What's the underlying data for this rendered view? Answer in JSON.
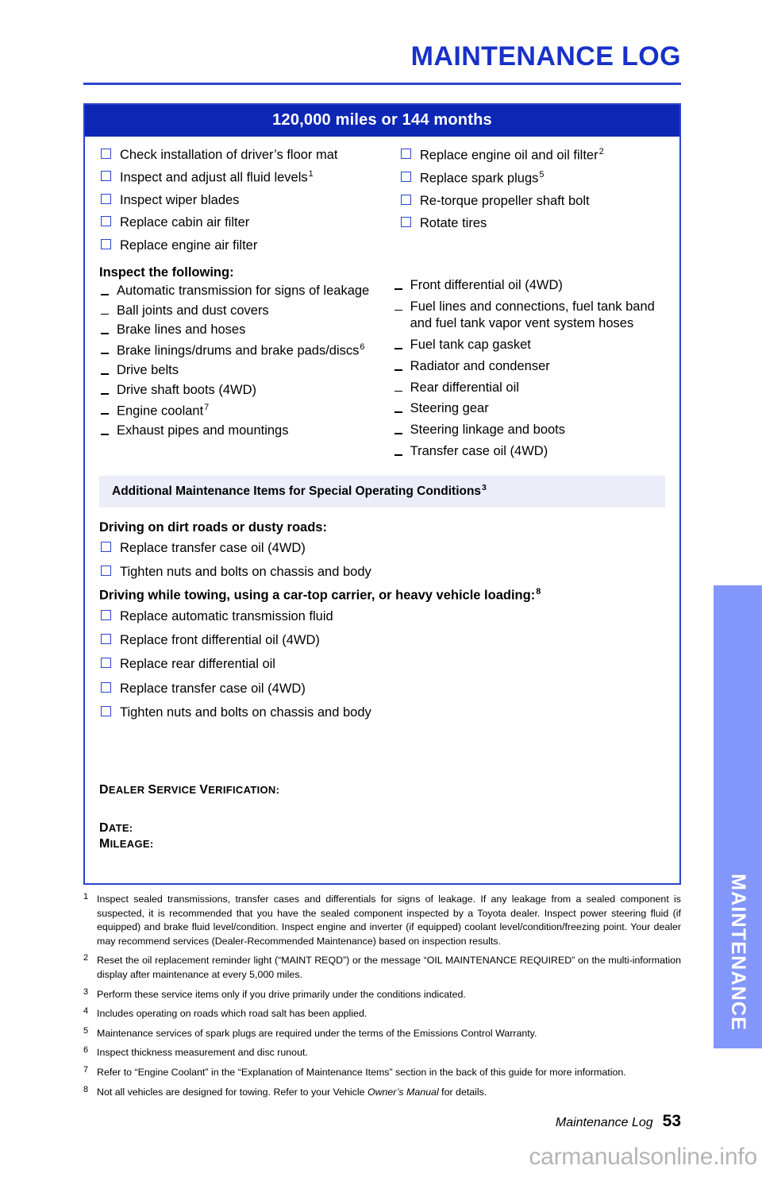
{
  "page": {
    "title": "MAINTENANCE LOG",
    "footer_label": "Maintenance Log",
    "page_number": "53",
    "side_tab": "MAINTENANCE",
    "watermark": "carmanualsonline.info"
  },
  "colors": {
    "brand_blue": "#1731c9",
    "header_bar": "#0d27b5",
    "border_blue": "#2b44cc",
    "banner_bg": "#ebedf8",
    "tab_blue": "#8296fb"
  },
  "log": {
    "interval_header": "120,000 miles or 144 months",
    "checklist_left": [
      {
        "label": "Check installation of driver’s floor mat",
        "note": ""
      },
      {
        "label": "Inspect and adjust all fluid levels",
        "note": "1"
      },
      {
        "label": "Inspect wiper blades",
        "note": ""
      },
      {
        "label": "Replace cabin air filter",
        "note": ""
      },
      {
        "label": "Replace engine air filter",
        "note": ""
      }
    ],
    "checklist_right": [
      {
        "label": "Replace engine oil and oil filter",
        "note": "2"
      },
      {
        "label": "Replace spark plugs",
        "note": "5"
      },
      {
        "label": "Re-torque propeller shaft bolt",
        "note": ""
      },
      {
        "label": "Rotate tires",
        "note": ""
      }
    ],
    "inspect_heading": "Inspect the following:",
    "inspect_left": [
      {
        "label": "Automatic transmission for signs of leakage",
        "note": ""
      },
      {
        "label": "Ball joints and dust covers",
        "note": ""
      },
      {
        "label": "Brake lines and hoses",
        "note": ""
      },
      {
        "label": "Brake linings/drums and brake pads/discs",
        "note": "6"
      },
      {
        "label": "Drive belts",
        "note": ""
      },
      {
        "label": "Drive shaft boots (4WD)",
        "note": ""
      },
      {
        "label": "Engine coolant",
        "note": "7"
      },
      {
        "label": "Exhaust pipes and mountings",
        "note": ""
      }
    ],
    "inspect_right": [
      {
        "label": "Front differential oil (4WD)",
        "note": ""
      },
      {
        "label": "Fuel lines and connections, fuel tank band and fuel tank vapor vent system hoses",
        "note": ""
      },
      {
        "label": "Fuel tank cap gasket",
        "note": ""
      },
      {
        "label": "Radiator and condenser",
        "note": ""
      },
      {
        "label": "Rear differential oil",
        "note": ""
      },
      {
        "label": "Steering gear",
        "note": ""
      },
      {
        "label": "Steering linkage and boots",
        "note": ""
      },
      {
        "label": "Transfer case oil (4WD)",
        "note": ""
      }
    ],
    "special_banner": "Additional Maintenance Items for Special Operating Conditions",
    "special_banner_note": "3",
    "special_groups": [
      {
        "heading": "Driving on dirt roads or dusty roads:",
        "heading_note": "",
        "items": [
          "Replace transfer case oil (4WD)",
          "Tighten nuts and bolts on chassis and body"
        ]
      },
      {
        "heading": "Driving while towing, using a car-top carrier, or heavy vehicle loading:",
        "heading_note": "8",
        "items": [
          "Replace automatic transmission fluid",
          "Replace front differential oil (4WD)",
          "Replace rear differential oil",
          "Replace transfer case oil (4WD)",
          "Tighten nuts and bolts on chassis and body"
        ]
      }
    ],
    "dealer_verification_label": "Dealer Service Verification:",
    "date_label": "Date:",
    "mileage_label": "Mileage:"
  },
  "footnotes": [
    {
      "num": "1",
      "text": "Inspect sealed transmissions, transfer cases and differentials for signs of leakage. If any leakage from a sealed component is suspected, it is recommended that you have the sealed component inspected by a Toyota dealer. Inspect power steering fluid (if equipped) and brake fluid level/condition. Inspect engine and inverter (if equipped) coolant level/condition/freezing point. Your dealer may recommend services (Dealer-Recommended Maintenance) based on inspection results."
    },
    {
      "num": "2",
      "text": "Reset the oil replacement reminder light (“MAINT REQD”) or the message “OIL MAINTENANCE REQUIRED” on the multi-information display after maintenance at every 5,000 miles."
    },
    {
      "num": "3",
      "text": "Perform these service items only if you drive primarily under the conditions indicated."
    },
    {
      "num": "4",
      "text": "Includes operating on roads which road salt has been applied."
    },
    {
      "num": "5",
      "text": "Maintenance services of spark plugs are required under the terms of the Emissions Control Warranty."
    },
    {
      "num": "6",
      "text": "Inspect thickness measurement and disc runout."
    },
    {
      "num": "7",
      "text": "Refer to “Engine Coolant” in the “Explanation of Maintenance Items” section in the back of this guide for more information."
    },
    {
      "num": "8",
      "text": "Not all vehicles are designed for towing. Refer to your Vehicle Owner’s Manual for details.",
      "italic_part": "Owner’s Manual"
    }
  ]
}
